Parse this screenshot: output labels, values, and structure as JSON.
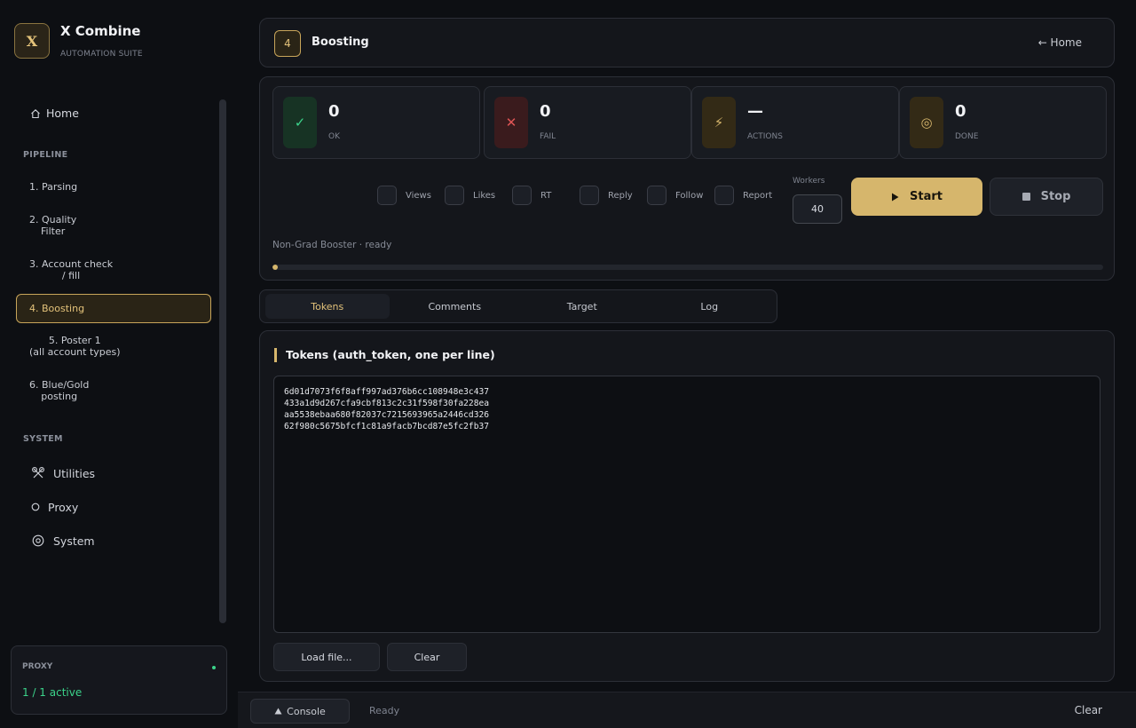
{
  "brand": {
    "logo": "X",
    "title": "X Combine",
    "subtitle": "AUTOMATION SUITE"
  },
  "nav": {
    "home_label": "Home",
    "pipeline_label": "PIPELINE",
    "steps": [
      {
        "label": "1. Parsing"
      },
      {
        "label": "2. Quality\nFilter"
      },
      {
        "label": "3. Account check\n/ fill"
      },
      {
        "label": "4. Boosting"
      },
      {
        "label": "5. Poster 1\n(all account types)"
      },
      {
        "label": "6. Blue/Gold\nposting"
      }
    ],
    "active_step": 3,
    "system_label": "SYSTEM",
    "system_items": [
      {
        "label": "Utilities",
        "icon": "tools-icon"
      },
      {
        "label": "Proxy",
        "icon": "circle-icon"
      },
      {
        "label": "System",
        "icon": "gear-icon"
      }
    ]
  },
  "proxy": {
    "label": "PROXY",
    "value": "1 / 1 active",
    "status_color": "#3bd38a"
  },
  "header": {
    "step_number": "4",
    "title": "Boosting",
    "home_link": "← Home"
  },
  "stats": [
    {
      "value": "0",
      "label": "OK",
      "icon": "check-icon",
      "glyph": "✓",
      "color": "#3bd38a",
      "bg": "#173324"
    },
    {
      "value": "0",
      "label": "FAIL",
      "icon": "x-icon",
      "glyph": "✕",
      "color": "#e05555",
      "bg": "#3a1b1d"
    },
    {
      "value": "—",
      "label": "ACTIONS",
      "icon": "bolt-icon",
      "glyph": "⚡",
      "color": "#d6b66c",
      "bg": "#332a16"
    },
    {
      "value": "0",
      "label": "DONE",
      "icon": "target-icon",
      "glyph": "◎",
      "color": "#d6b66c",
      "bg": "#332a16"
    }
  ],
  "options": [
    {
      "label": "Views",
      "checked": false
    },
    {
      "label": "Likes",
      "checked": false
    },
    {
      "label": "RT",
      "checked": false
    },
    {
      "label": "Reply",
      "checked": false
    },
    {
      "label": "Follow",
      "checked": false
    },
    {
      "label": "Report",
      "checked": false
    }
  ],
  "workers": {
    "label": "Workers",
    "value": "40"
  },
  "controls": {
    "start_label": "Start",
    "stop_label": "Stop"
  },
  "status": {
    "text": "Non-Grad Booster · ready",
    "progress": 0
  },
  "tabs": [
    {
      "label": "Tokens"
    },
    {
      "label": "Comments"
    },
    {
      "label": "Target"
    },
    {
      "label": "Log"
    }
  ],
  "active_tab": 0,
  "tokens": {
    "title": "Tokens (auth_token, one per line)",
    "value": "6d01d7073f6f8aff997ad376b6cc108948e3c437\n433a1d9d267cfa9cbf813c2c31f598f30fa228ea\naa5538ebaa680f82037c7215693965a2446cd326\n62f980c5675bfcf1c81a9facb7bcd87e5fc2fb37",
    "load_label": "Load file...",
    "clear_label": "Clear"
  },
  "console": {
    "button_label": "Console",
    "status": "Ready",
    "clear_label": "Clear"
  },
  "colors": {
    "accent": "#d6b66c",
    "success": "#3bd38a",
    "danger": "#e05555"
  }
}
